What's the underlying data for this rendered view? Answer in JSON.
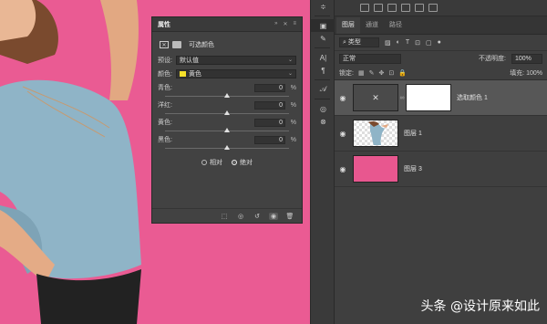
{
  "colors": {
    "canvas_bg": "#ea5b93",
    "accent_yellow": "#f5e02a",
    "layer3_fill": "#e8578f"
  },
  "properties": {
    "title": "属性",
    "adjustment_label": "可选颜色",
    "preset_label": "预设:",
    "preset_value": "默认值",
    "colors_label": "颜色:",
    "colors_value": "黄色",
    "sliders": [
      {
        "name": "青色:",
        "value": "0",
        "unit": "%",
        "level": 0
      },
      {
        "name": "洋红:",
        "value": "0",
        "unit": "%",
        "level": 0
      },
      {
        "name": "黄色:",
        "value": "0",
        "unit": "%",
        "level": 0
      },
      {
        "name": "黑色:",
        "value": "0",
        "unit": "%",
        "level": 0
      }
    ],
    "method_relative": "相对",
    "method_absolute": "绝对",
    "method_selected": "绝对"
  },
  "layers_panel": {
    "tabs": [
      "图层",
      "通道",
      "路径"
    ],
    "active_tab": "图层",
    "filter_kind": "类型",
    "blend_mode": "正常",
    "opacity_label": "不透明度:",
    "opacity_value": "100%",
    "lock_label": "锁定:",
    "fill_label": "填充:",
    "fill_value": "100%",
    "layers": [
      {
        "name": "选取颜色 1",
        "type": "adjustment",
        "selected": true
      },
      {
        "name": "图层 1",
        "type": "image",
        "selected": false
      },
      {
        "name": "图层 3",
        "type": "fill",
        "selected": false
      }
    ]
  },
  "watermark": "头条 @设计原来如此"
}
